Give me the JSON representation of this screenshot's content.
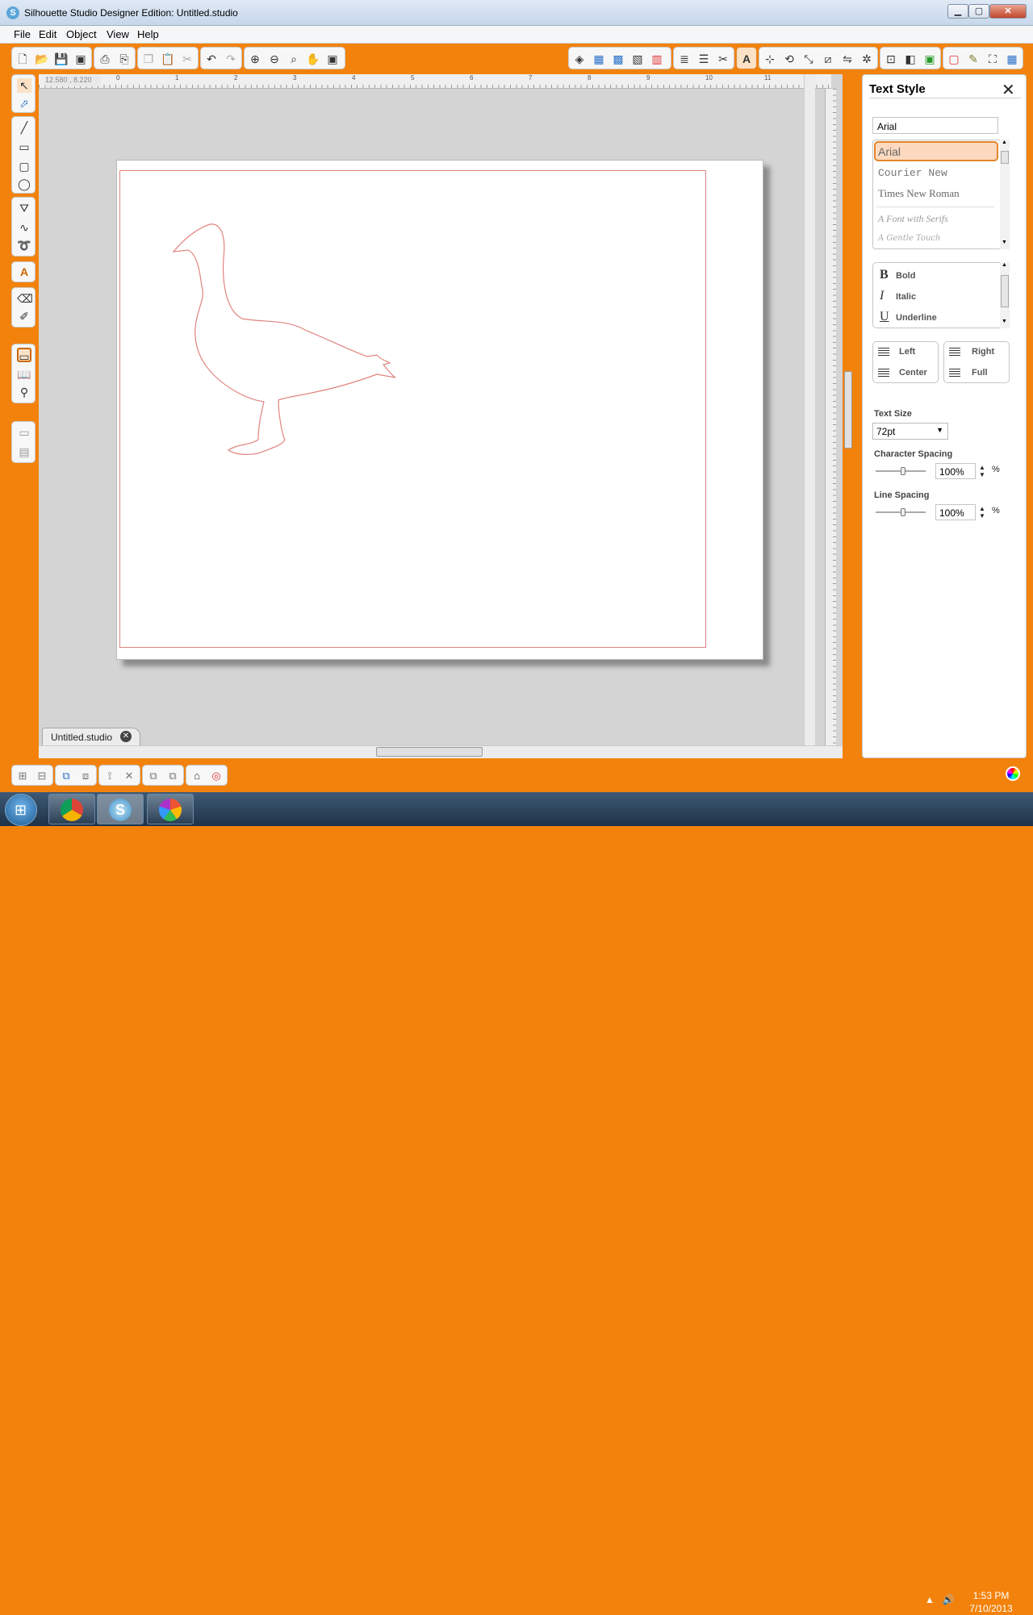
{
  "window": {
    "title": "Silhouette Studio Designer Edition: Untitled.studio",
    "app_icon": "S",
    "min": "▁",
    "max": "▢",
    "close": "✕"
  },
  "menu": [
    "File",
    "Edit",
    "Object",
    "View",
    "Help"
  ],
  "toolbar_icons": [
    "new-icon",
    "open-icon",
    "save-icon",
    "save-library-icon",
    "print-icon",
    "send-to-cutter-icon",
    "copy-icon",
    "paste-icon",
    "cut-icon",
    "undo-icon",
    "redo-icon",
    "zoom-in-icon",
    "zoom-out-icon",
    "zoom-select-icon",
    "pan-icon",
    "fit-page-icon"
  ],
  "ruler": {
    "coords": "12.580 , 8.220",
    "top_marks": [
      "0",
      "1",
      "2",
      "3",
      "4",
      "5",
      "6",
      "7",
      "8",
      "9",
      "10",
      "11"
    ]
  },
  "document": {
    "tab_label": "Untitled.studio",
    "tab_close": "✕"
  },
  "panel": {
    "title": "Text Style",
    "close": "✕",
    "font_field": "Arial",
    "fonts": [
      "Arial",
      "Courier New",
      "Times New Roman",
      "A Font with Serifs",
      "A Gentle Touch"
    ],
    "styles": [
      {
        "glyph": "B",
        "label": "Bold"
      },
      {
        "glyph": "I",
        "label": "Italic"
      },
      {
        "glyph": "U",
        "label": "Underline"
      }
    ],
    "align_left": [
      "Left",
      "Center"
    ],
    "align_right": [
      "Right",
      "Full"
    ],
    "text_size_label": "Text Size",
    "text_size_value": "72pt",
    "char_spacing_label": "Character Spacing",
    "char_spacing_value": "100%",
    "line_spacing_label": "Line Spacing",
    "line_spacing_value": "100%",
    "pct": "%"
  },
  "taskbar": {
    "time": "1:53 PM",
    "date": "7/10/2013"
  },
  "colors": {
    "accent": "#f3820c",
    "cut_line": "#e08480",
    "selected_font_bg": "#fcd9bf"
  }
}
